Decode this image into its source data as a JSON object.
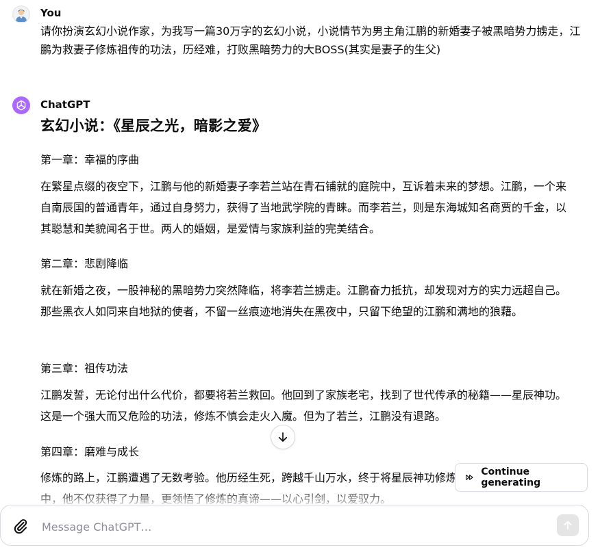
{
  "user_message": {
    "author": "You",
    "text": "请你扮演玄幻小说作家，为我写一篇30万字的玄幻小说，小说情节为男主角江鹏的新婚妻子被黑暗势力掳走，江鹏为救妻子修炼祖传的功法，历经难，打败黑暗势力的大BOSS(其实是妻子的生父)"
  },
  "assistant_message": {
    "author": "ChatGPT",
    "title": "玄幻小说：《星辰之光，暗影之爱》",
    "chapters": [
      {
        "heading": "第一章：幸福的序曲",
        "body": "在繁星点缀的夜空下，江鹏与他的新婚妻子李若兰站在青石铺就的庭院中，互诉着未来的梦想。江鹏，一个来自南辰国的普通青年，通过自身努力，获得了当地武学院的青睐。而李若兰，则是东海城知名商贾的千金，以其聪慧和美貌闻名于世。两人的婚姻，是爱情与家族利益的完美结合。"
      },
      {
        "heading": "第二章：悲剧降临",
        "body": "就在新婚之夜，一股神秘的黑暗势力突然降临，将李若兰掳走。江鹏奋力抵抗，却发现对方的实力远超自己。那些黑衣人如同来自地狱的使者，不留一丝痕迹地消失在黑夜中，只留下绝望的江鹏和满地的狼藉。"
      },
      {
        "heading": "第三章：祖传功法",
        "body": "江鹏发誓，无论付出什么代价，都要将若兰救回。他回到了家族老宅，找到了世代传承的秘籍——星辰神功。这是一个强大而又危险的功法，修炼不慎会走火入魔。但为了若兰，江鹏没有退路。"
      },
      {
        "heading": "第四章：磨难与成长",
        "body": "修炼的路上，江鹏遭遇了无数考验。他历经生死，跨越千山万水，终于将星辰神功修炼至大成。在这个过程中，他不仅获得了力量，更领悟了修炼的真谛——以心引剑，以爱驭力。"
      }
    ]
  },
  "controls": {
    "continue_label": "Continue generating",
    "input_placeholder": "Message ChatGPT…"
  },
  "colors": {
    "assistant_avatar_bg": "#ab68ff",
    "border": "#d9d9e3",
    "placeholder": "#8e8ea0",
    "send_disabled_bg": "#e5e5e5"
  }
}
